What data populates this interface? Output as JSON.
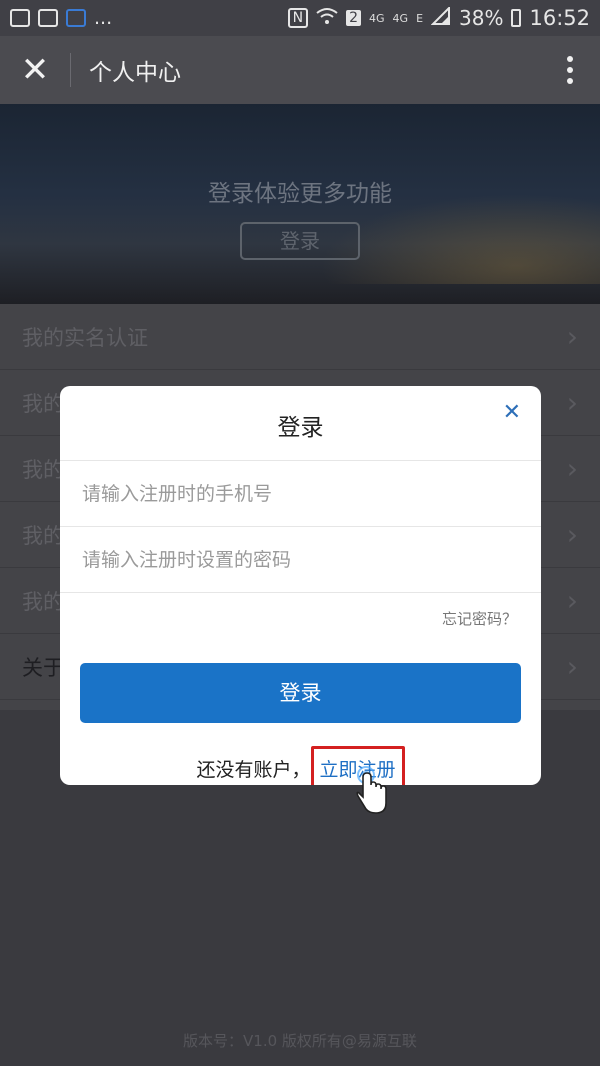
{
  "status_bar": {
    "dots": "...",
    "nfc": "N",
    "sim": "2",
    "net1": "4G",
    "net2": "4G",
    "net3": "E",
    "battery": "38%",
    "time": "16:52"
  },
  "header": {
    "close_icon": "close-icon",
    "title": "个人中心",
    "more_icon": "more-vertical-icon"
  },
  "banner": {
    "text": "登录体验更多功能",
    "button": "登录"
  },
  "menu": {
    "items": [
      {
        "label": "我的实名认证"
      },
      {
        "label": "我的"
      },
      {
        "label": "我的"
      },
      {
        "label": "我的"
      },
      {
        "label": "我的"
      },
      {
        "label": "关于"
      }
    ]
  },
  "footer": "版本号：V1.0 版权所有@易源互联",
  "dialog": {
    "title": "登录",
    "phone_placeholder": "请输入注册时的手机号",
    "password_placeholder": "请输入注册时设置的密码",
    "forgot": "忘记密码？",
    "login_button": "登录",
    "no_account": "还没有账户，",
    "register": "立即注册"
  },
  "colors": {
    "accent": "#1a73c7",
    "highlight": "#d42020"
  }
}
